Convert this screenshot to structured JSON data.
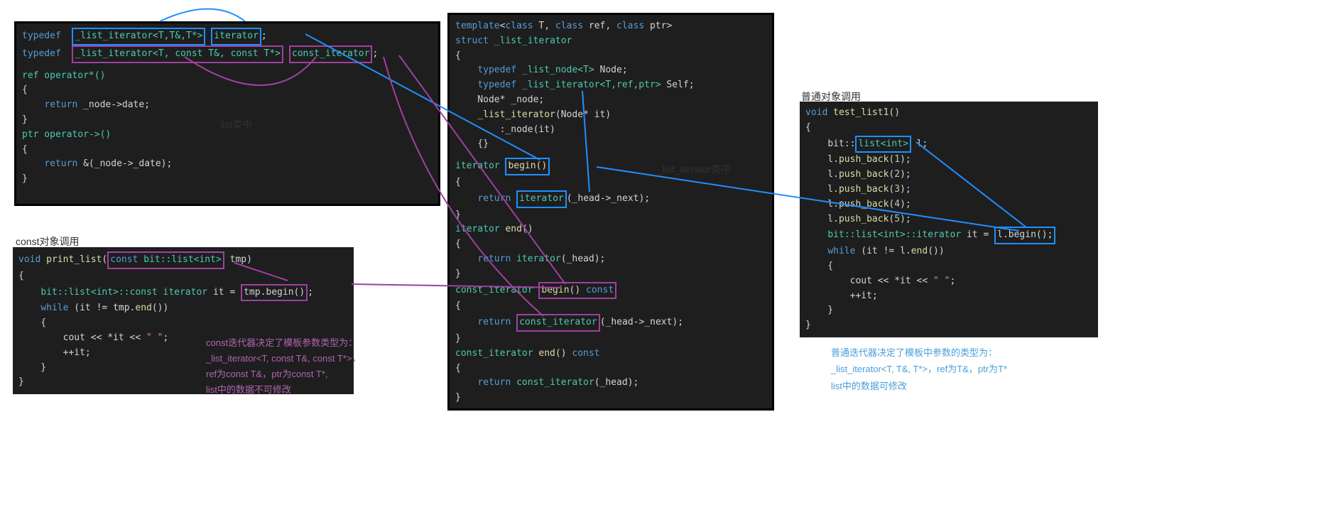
{
  "panel1": {
    "label_inside": "list类中",
    "line1_p1": "typedef",
    "line1_p2": "_list_iterator<T,T&,T*>",
    "line1_p3": "iterator",
    "line2_p1": "typedef",
    "line2_p2": "_list_iterator<T, const T&, const T*>",
    "line2_p3": "const_iterator",
    "ref_op": "ref operator*()",
    "ref_body": "return _node->date;",
    "ptr_op": "ptr operator->()",
    "ptr_body": "return &(_node->_date);"
  },
  "panel2": {
    "title": "const对象调用",
    "sig_p1": "void",
    "sig_p2": "print_list",
    "sig_p3": "const bit::list<int>",
    "sig_p4": "tmp",
    "l1_p1": "bit::list<int>::const iterator it =",
    "l1_p2": "tmp.begin()",
    "l2": "while (it != tmp.end())",
    "l3": "cout << *it << \" \";",
    "l4": "++it;"
  },
  "note_purple": {
    "l1": "const迭代器决定了模板参数类型为：",
    "l2": "_list_iterator<T, const T&, const T*>，",
    "l3": "ref为const T&，ptr为const T*,",
    "l4": "list中的数据不可修改"
  },
  "panel3": {
    "label": "_list_iterator类中",
    "t1": "template<class T, class ref, class ptr>",
    "t2": "struct _list_iterator",
    "t3": "typedef _list_node<T> Node;",
    "t4": "typedef _list_iterator<T,ref,ptr> Self;",
    "t5": "Node* _node;",
    "t6": "_list_iterator(Node* it)",
    "t7": ":_node(it)",
    "b1_p1": "iterator",
    "b1_p2": "begin()",
    "b1_body_p1": "return",
    "b1_body_p2": "iterator",
    "b1_body_p3": "(_head->_next);",
    "b2": "iterator end()",
    "b2_body": "return iterator(_head);",
    "b3_p1": "const_iterator",
    "b3_p2": "begin() const",
    "b3_body_p1": "return",
    "b3_body_p2": "const_iterator",
    "b3_body_p3": "(_head->_next);",
    "b4": "const_iterator end() const",
    "b4_body": "return const_iterator(_head);"
  },
  "panel4": {
    "title": "普通对象调用",
    "sig": "void test_list1()",
    "l1_p1": "bit::",
    "l1_p2": "list<int>",
    "l1_p3": "l;",
    "l2": "l.push_back(1);",
    "l3": "l.push_back(2);",
    "l4": "l.push_back(3);",
    "l5": "l.push_back(4);",
    "l6": "l.push_back(5);",
    "l7_p1": "bit::list<int>::iterator it =",
    "l7_p2": "l.begin();",
    "l8": "while (it != l.end())",
    "l9": "cout << *it << \" \";",
    "l10": "++it;"
  },
  "note_blue": {
    "l1": "普通迭代器决定了模板中参数的类型为：",
    "l2": "_list_iterator<T, T&, T*>，ref为T&，ptr为T*",
    "l3": "list中的数据可修改"
  }
}
